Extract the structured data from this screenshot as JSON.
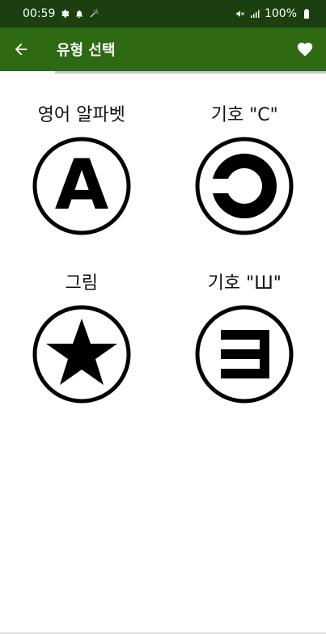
{
  "status_bar": {
    "time": "00:59",
    "battery": "100%",
    "icons_left": [
      "gear-icon",
      "bell-icon",
      "wand-icon"
    ],
    "icons_right": [
      "mute-icon",
      "signal-icon",
      "battery-icon"
    ]
  },
  "app_bar": {
    "title": "유형 선택",
    "back_icon": "arrow-left-icon",
    "favorite_icon": "heart-icon",
    "color": "#2d6a12"
  },
  "options": [
    {
      "label": "영어 알파벳",
      "symbol": "letter-a-icon",
      "symbol_text": "A"
    },
    {
      "label": "기호 \"C\"",
      "symbol": "landolt-c-icon"
    },
    {
      "label": "그림",
      "symbol": "star-icon"
    },
    {
      "label": "기호 \"Ш\"",
      "symbol": "tumbling-e-icon"
    }
  ]
}
